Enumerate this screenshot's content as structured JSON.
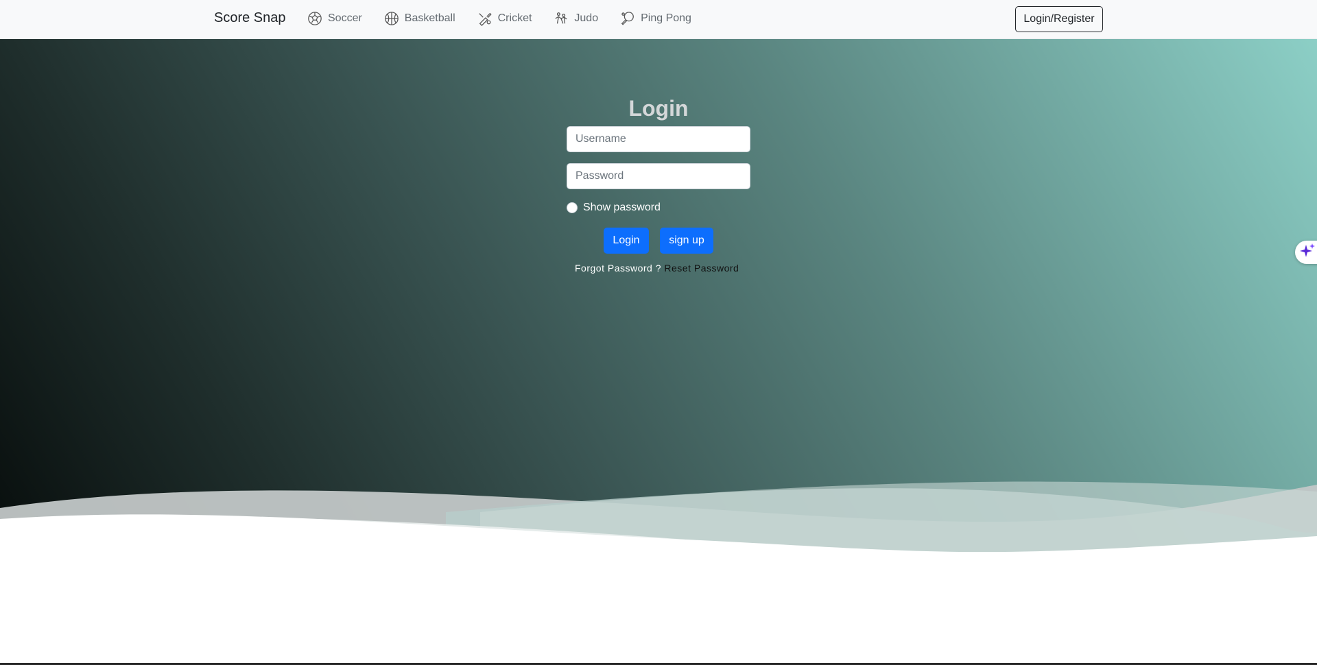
{
  "navbar": {
    "brand": "Score Snap",
    "items": [
      {
        "label": "Soccer",
        "icon": "soccer-ball-icon"
      },
      {
        "label": "Basketball",
        "icon": "basketball-icon"
      },
      {
        "label": "Cricket",
        "icon": "cricket-icon"
      },
      {
        "label": "Judo",
        "icon": "judo-icon"
      },
      {
        "label": "Ping Pong",
        "icon": "ping-pong-icon"
      }
    ],
    "login_register": "Login/Register"
  },
  "login": {
    "title": "Login",
    "username_placeholder": "Username",
    "password_placeholder": "Password",
    "show_password": "Show password",
    "login_button": "Login",
    "signup_button": "sign up",
    "forgot_text": "Forgot Password ?",
    "reset_link": "Reset Password"
  },
  "colors": {
    "primary_button": "#0d6efd",
    "navbar_bg": "#f8f9fa",
    "gradient_start": "#030706",
    "gradient_end": "#8ccfc6"
  },
  "floating": {
    "icon": "sparkle-icon"
  }
}
